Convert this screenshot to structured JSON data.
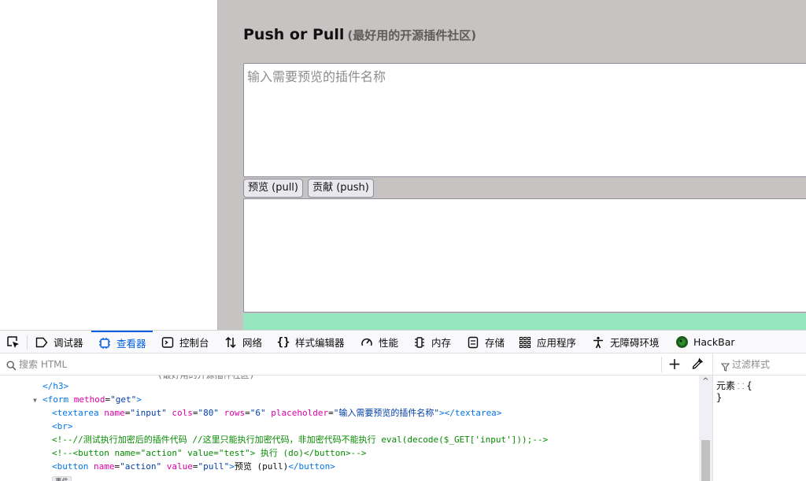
{
  "page": {
    "title_main": "Push or Pull",
    "title_sub": "(最好用的开源插件社区)",
    "input_placeholder": "输入需要预览的插件名称",
    "preview_button": "预览 (pull)",
    "contribute_button": "贡献 (push)"
  },
  "devtools": {
    "tabs": [
      {
        "label": "调试器",
        "icon": "debugger-icon"
      },
      {
        "label": "查看器",
        "icon": "inspector-icon",
        "active": true
      },
      {
        "label": "控制台",
        "icon": "console-icon"
      },
      {
        "label": "网络",
        "icon": "network-icon"
      },
      {
        "label": "样式编辑器",
        "icon": "style-editor-icon"
      },
      {
        "label": "性能",
        "icon": "performance-icon"
      },
      {
        "label": "内存",
        "icon": "memory-icon"
      },
      {
        "label": "存储",
        "icon": "storage-icon"
      },
      {
        "label": "应用程序",
        "icon": "application-icon"
      },
      {
        "label": "无障碍环境",
        "icon": "accessibility-icon"
      },
      {
        "label": "HackBar",
        "icon": "hackbar-icon"
      }
    ],
    "search_placeholder": "搜索 HTML",
    "rules_filter_placeholder": "过滤样式",
    "rules": {
      "selector": "元素",
      "open": "{",
      "close": "}"
    },
    "markup": {
      "cutoff_line": "(最好用的开源插件社区)",
      "h3_close": "</h3>",
      "form_tag": "form",
      "form_attr_name": "method",
      "form_attr_value": "\"get\"",
      "textarea_tag": "textarea",
      "textarea_attrs": [
        {
          "name": "name",
          "value": "\"input\""
        },
        {
          "name": "cols",
          "value": "\"80\""
        },
        {
          "name": "rows",
          "value": "\"6\""
        },
        {
          "name": "placeholder",
          "value": "\"输入需要预览的插件名称\""
        }
      ],
      "br_tag": "<br>",
      "comment1": "<!--//测试执行加密后的插件代码 //这里只能执行加密代码，非加密代码不能执行 eval(decode($_GET['input']));-->",
      "comment2": "<!--<button name=\"action\" value=\"test\"> 执行 (do)</button>-->",
      "button_tag": "button",
      "button_attrs": [
        {
          "name": "name",
          "value": "\"action\""
        },
        {
          "name": "value",
          "value": "\"pull\""
        }
      ],
      "button_text": "预览 (pull)",
      "event_badge": "事件"
    }
  },
  "colors": {
    "page_background": "#c6c3c2",
    "green_bar": "#96e6c0",
    "devtools_accent": "#0060df",
    "tag_color": "#0074e8",
    "attr_name_color": "#dd00a9",
    "attr_value_color": "#003eaa",
    "comment_color": "#058b00"
  }
}
